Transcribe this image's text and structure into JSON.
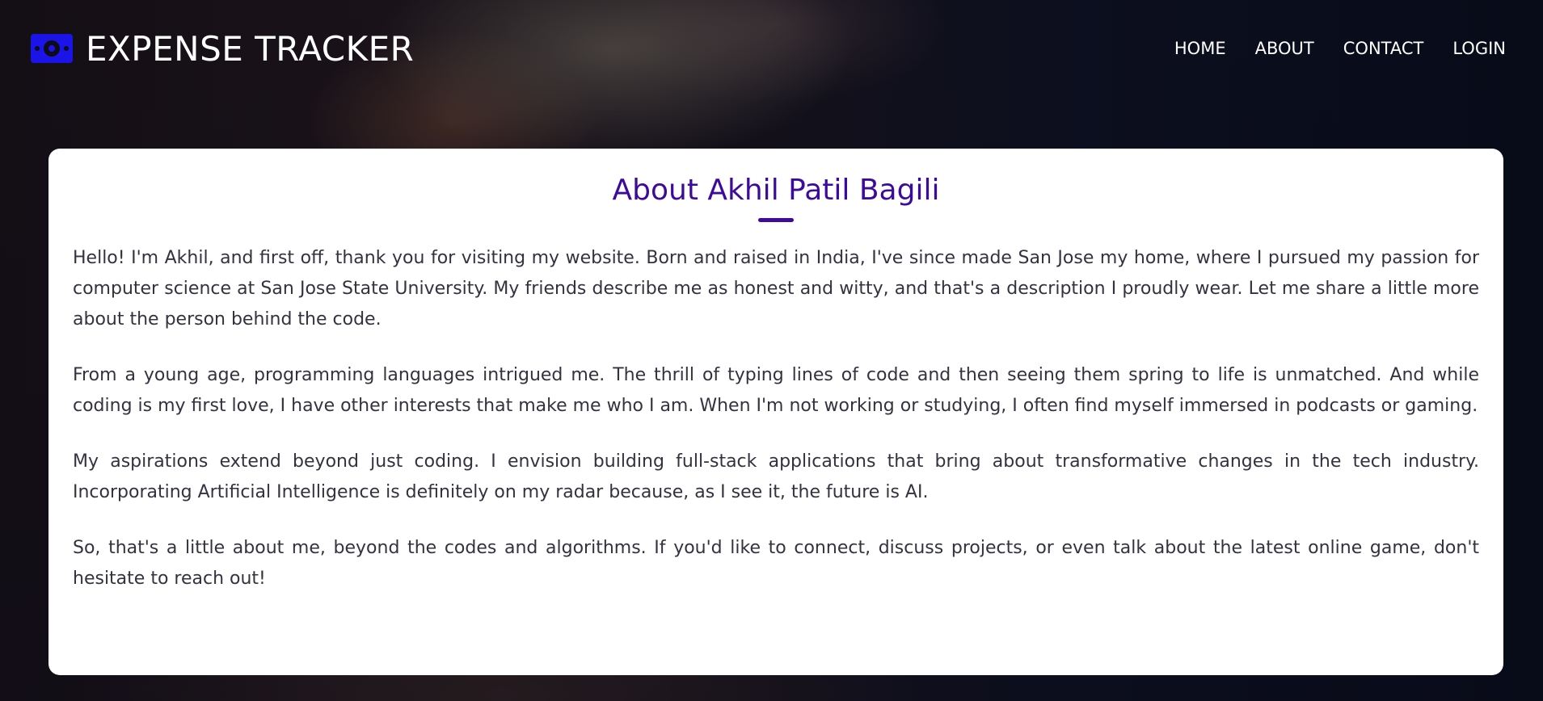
{
  "header": {
    "title": "EXPENSE TRACKER",
    "logo_icon": "money-bill-icon",
    "nav": [
      "HOME",
      "ABOUT",
      "CONTACT",
      "LOGIN"
    ]
  },
  "about": {
    "heading": "About Akhil Patil Bagili",
    "paragraphs": [
      "Hello! I'm Akhil, and first off, thank you for visiting my website. Born and raised in India, I've since made San Jose my home, where I pursued my passion for computer science at San Jose State University. My friends describe me as honest and witty, and that's a description I proudly wear. Let me share a little more about the person behind the code.",
      "From a young age, programming languages intrigued me. The thrill of typing lines of code and then seeing them spring to life is unmatched. And while coding is my first love, I have other interests that make me who I am. When I'm not working or studying, I often find myself immersed in podcasts or gaming.",
      "My aspirations extend beyond just coding. I envision building full-stack applications that bring about transformative changes in the tech industry. Incorporating Artificial Intelligence is definitely on my radar because, as I see it, the future is AI.",
      "So, that's a little about me, beyond the codes and algorithms. If you'd like to connect, discuss projects, or even talk about the latest online game, don't hesitate to reach out!"
    ]
  },
  "colors": {
    "accent": "#3d0a9e",
    "logo": "#1a14e8",
    "card_bg": "#ffffff",
    "body_text": "#333340"
  }
}
